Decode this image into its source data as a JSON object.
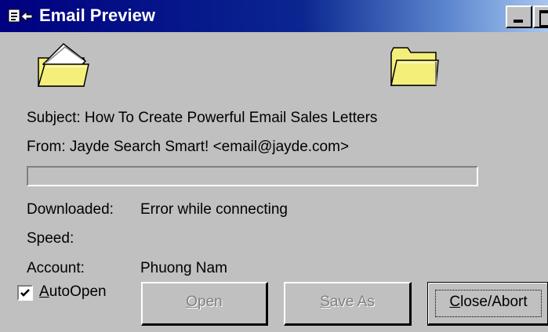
{
  "window": {
    "title": "Email Preview",
    "app_icon": "email-preview-icon",
    "controls": [
      "minimize-icon",
      "maximize-icon"
    ]
  },
  "icons": {
    "left": "open-folder-with-letter-icon",
    "right": "folder-icon"
  },
  "message": {
    "subject": "Subject: How To Create Powerful Email Sales Letters",
    "from": "From: Jayde Search Smart! <email@jayde.com>"
  },
  "progress": {
    "value": 0
  },
  "status": {
    "downloaded_label": "Downloaded:",
    "downloaded_value": "Error while connecting",
    "speed_label": "Speed:",
    "speed_value": "",
    "account_label": "Account:",
    "account_value": "Phuong Nam"
  },
  "autoopen": {
    "label_mnemonic": "A",
    "label_rest": "utoOpen",
    "checked": true
  },
  "buttons": {
    "open": {
      "mnemonic": "O",
      "rest": "pen",
      "enabled": false
    },
    "save_as": {
      "mnemonic": "S",
      "rest": "ave As",
      "enabled": false
    },
    "close": {
      "mnemonic": "C",
      "rest": "lose/Abort",
      "enabled": true
    }
  },
  "colors": {
    "title_bar": "#000080",
    "face": "#c0c0c0",
    "folder": "#f3ef7a"
  }
}
